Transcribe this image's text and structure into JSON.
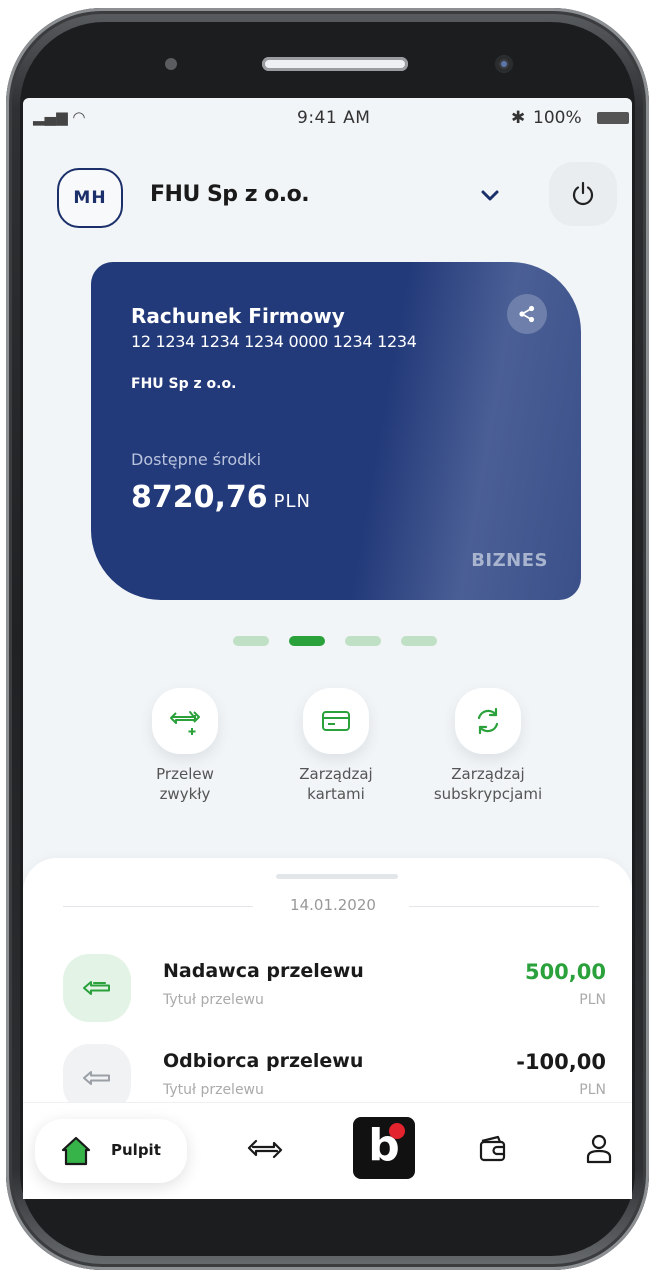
{
  "status_bar": {
    "time": "9:41 AM",
    "battery": "100%"
  },
  "header": {
    "avatar_initials": "MH",
    "company_name": "FHU Sp z o.o."
  },
  "account_card": {
    "name": "Rachunek Firmowy",
    "iban": "12 1234 1234 1234 0000 1234 1234",
    "owner": "FHU Sp z o.o.",
    "available_label": "Dostępne środki",
    "balance": "8720,76",
    "currency": "PLN",
    "type": "BIZNES"
  },
  "pager": {
    "count": 4,
    "active_index": 1
  },
  "quick_actions": [
    {
      "line1": "Przelew",
      "line2": "zwykły",
      "icon": "transfer-plus-icon"
    },
    {
      "line1": "Zarządzaj",
      "line2": "kartami",
      "icon": "card-icon"
    },
    {
      "line1": "Zarządzaj",
      "line2": "subskrypcjami",
      "icon": "refresh-icon"
    }
  ],
  "history": {
    "date": "14.01.2020",
    "transactions": [
      {
        "title": "Nadawca przelewu",
        "subtitle": "Tytuł przelewu",
        "amount": "500,00",
        "currency": "PLN",
        "type": "incoming"
      },
      {
        "title": "Odbiorca przelewu",
        "subtitle": "Tytuł przelewu",
        "amount": "-100,00",
        "currency": "PLN",
        "type": "outgoing"
      }
    ]
  },
  "bottom_nav": {
    "home_label": "Pulpit"
  },
  "colors": {
    "brand_navy": "#233a7a",
    "accent_green": "#2aa13a",
    "positive_amount": "#2aa13a",
    "negative_amount": "#1a1a1a"
  }
}
